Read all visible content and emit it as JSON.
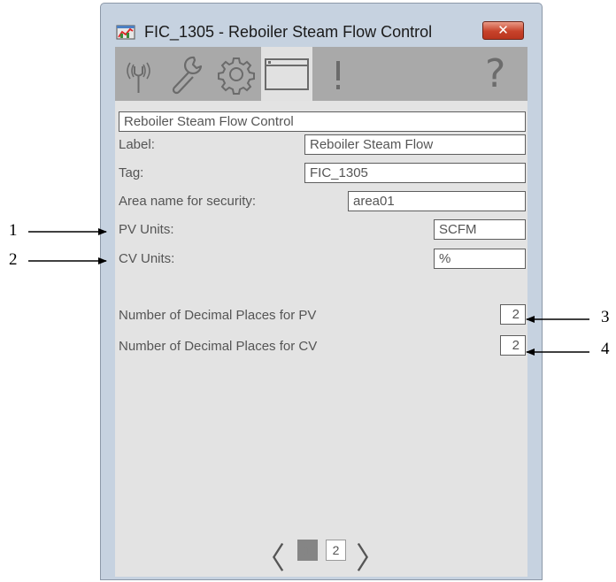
{
  "window": {
    "title": "FIC_1305 - Reboiler Steam Flow Control",
    "close_label": "✕"
  },
  "toolbar": {
    "tabs": [
      {
        "icon": "signal-icon"
      },
      {
        "icon": "wrench-icon"
      },
      {
        "icon": "gear-icon"
      },
      {
        "icon": "window-icon"
      },
      {
        "icon": "alarm-icon"
      }
    ],
    "help_label": "?"
  },
  "form": {
    "description": "Reboiler Steam Flow Control",
    "label_label": "Label:",
    "label_value": "Reboiler Steam Flow",
    "tag_label": "Tag:",
    "tag_value": "FIC_1305",
    "area_label": "Area name for security:",
    "area_value": "area01",
    "pv_units_label": "PV Units:",
    "pv_units_value": "SCFM",
    "cv_units_label": "CV Units:",
    "cv_units_value": "%",
    "pv_decimals_label": "Number of Decimal Places for PV",
    "pv_decimals_value": "2",
    "cv_decimals_label": "Number of Decimal Places for CV",
    "cv_decimals_value": "2"
  },
  "pager": {
    "prev": "〈",
    "next": "〉",
    "pages": [
      "1",
      "2"
    ],
    "current_page": "1"
  },
  "callouts": [
    "1",
    "2",
    "3",
    "4"
  ]
}
